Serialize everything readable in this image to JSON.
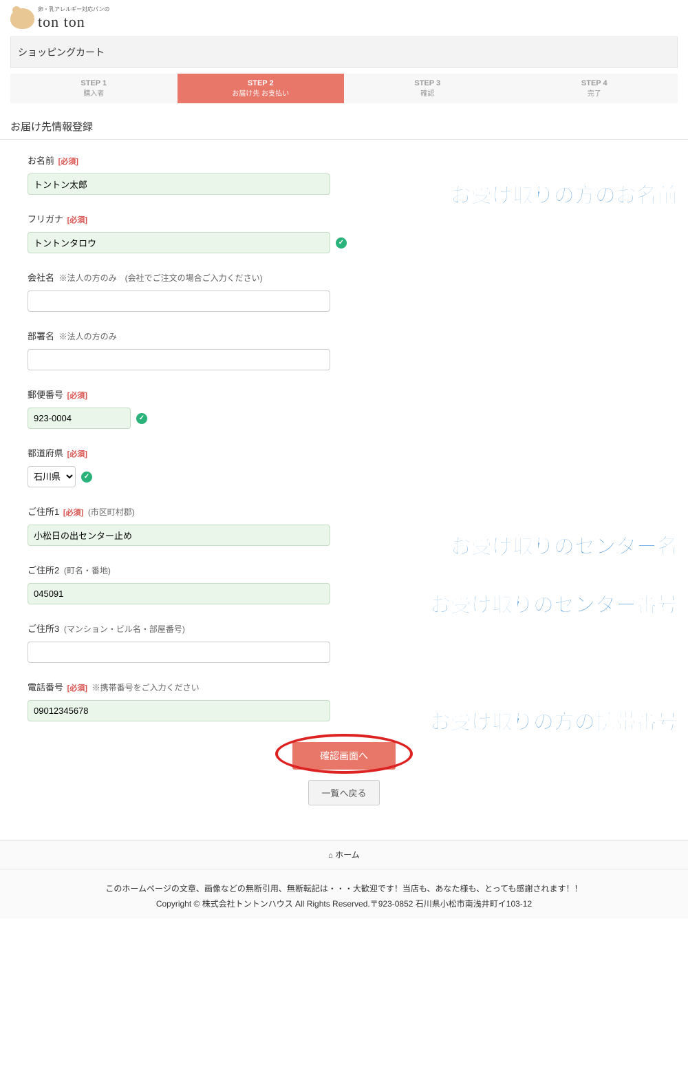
{
  "logo": {
    "tagline": "卵・乳アレルギー対応パンの",
    "brand": "ton ton"
  },
  "page_title": "ショッピングカート",
  "steps": [
    {
      "num": "STEP 1",
      "label": "購入者"
    },
    {
      "num": "STEP 2",
      "label": "お届け先 お支払い"
    },
    {
      "num": "STEP 3",
      "label": "確認"
    },
    {
      "num": "STEP 4",
      "label": "完了"
    }
  ],
  "section_title": "お届け先情報登録",
  "form": {
    "name": {
      "label": "お名前",
      "required": "[必須]",
      "value": "トントン太郎",
      "annotation": "お受け取りの方のお名前"
    },
    "kana": {
      "label": "フリガナ",
      "required": "[必須]",
      "value": "トントンタロウ"
    },
    "company": {
      "label": "会社名",
      "hint": "※法人の方のみ　(会社でご注文の場合ご入力ください)",
      "value": ""
    },
    "dept": {
      "label": "部署名",
      "hint": "※法人の方のみ",
      "value": ""
    },
    "postal": {
      "label": "郵便番号",
      "required": "[必須]",
      "value": "923-0004"
    },
    "pref": {
      "label": "都道府県",
      "required": "[必須]",
      "selected": "石川県"
    },
    "addr1": {
      "label": "ご住所1",
      "required": "[必須]",
      "hint": "(市区町村郡)",
      "value": "小松日の出センター止め",
      "annotation": "お受け取りのセンター名"
    },
    "addr2": {
      "label": "ご住所2",
      "hint": "(町名・番地)",
      "value": "045091",
      "annotation": "お受け取りのセンター番号"
    },
    "addr3": {
      "label": "ご住所3",
      "hint": "(マンション・ビル名・部屋番号)",
      "value": ""
    },
    "phone": {
      "label": "電話番号",
      "required": "[必須]",
      "hint": "※携帯番号をご入力ください",
      "value": "09012345678",
      "annotation": "お受け取りの方の携帯番号"
    }
  },
  "buttons": {
    "submit": "確認画面へ",
    "back": "一覧へ戻る"
  },
  "footer": {
    "home": "ホーム",
    "line1": "このホームページの文章、画像などの無断引用、無断転記は・・・大歓迎です！当店も、あなた様も、とっても感謝されます！！",
    "line2": "Copyright © 株式会社トントンハウス All Rights Reserved.〒923-0852 石川県小松市南浅井町イ103-12"
  }
}
